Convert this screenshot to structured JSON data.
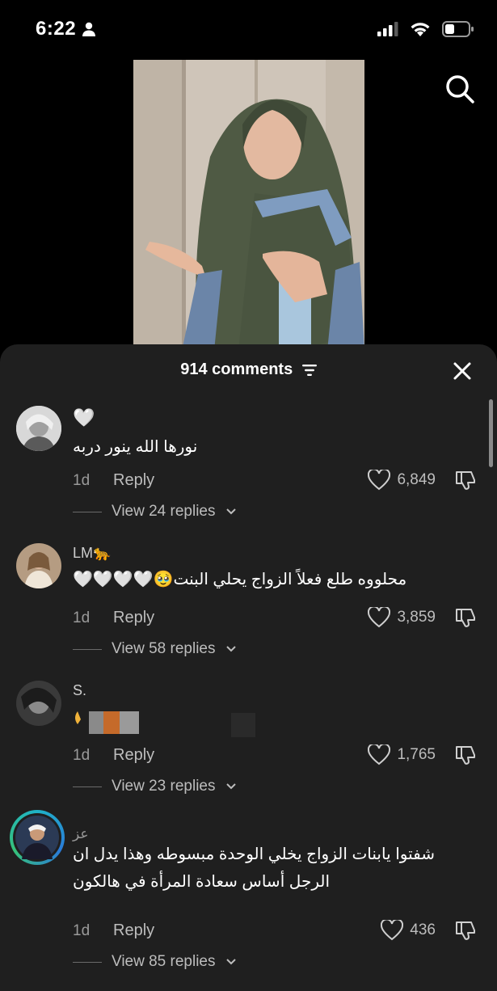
{
  "status_bar": {
    "time": "6:22"
  },
  "sheet": {
    "title": "914 comments"
  },
  "comments": [
    {
      "username": "",
      "emoji_line": "🤍",
      "text": "نورها الله ينور دربه",
      "age": "1d",
      "reply_label": "Reply",
      "likes": "6,849",
      "view_replies": "View 24 replies"
    },
    {
      "username": "LM🐆",
      "text": "محلووه طلع فعلاً الزواج يحلي البنت🥹🤍🤍🤍🤍",
      "age": "1d",
      "reply_label": "Reply",
      "likes": "3,859",
      "view_replies": "View 58 replies"
    },
    {
      "username": "S.",
      "text": "",
      "age": "1d",
      "reply_label": "Reply",
      "likes": "1,765",
      "view_replies": "View 23 replies"
    },
    {
      "username": "عز",
      "text": "شفتوا يابنات الزواج يخلي الوحدة مبسوطه وهذا يدل ان الرجل أساس سعادة المرأة في هالكون",
      "age": "1d",
      "reply_label": "Reply",
      "likes": "436",
      "view_replies": "View 85 replies"
    }
  ]
}
